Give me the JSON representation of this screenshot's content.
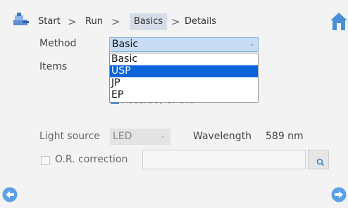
{
  "breadcrumb": {
    "items": [
      "Start",
      "Run",
      "Basics",
      "Details"
    ],
    "separator": ">",
    "active_index": 2
  },
  "method": {
    "label": "Method",
    "selected": "Basic",
    "options": [
      "Basic",
      "USP",
      "JP",
      "EP"
    ],
    "highlighted": "USP"
  },
  "items": {
    "label": "Items",
    "partial_text": "Accuracy of OR."
  },
  "light_source": {
    "label": "Light source",
    "value": "LED"
  },
  "wavelength": {
    "label": "Wavelength",
    "value": "589 nm"
  },
  "or_correction": {
    "label": "O.R. correction",
    "value": ""
  },
  "colors": {
    "accent": "#0a64d8",
    "nav_button": "#5aa0e8"
  }
}
